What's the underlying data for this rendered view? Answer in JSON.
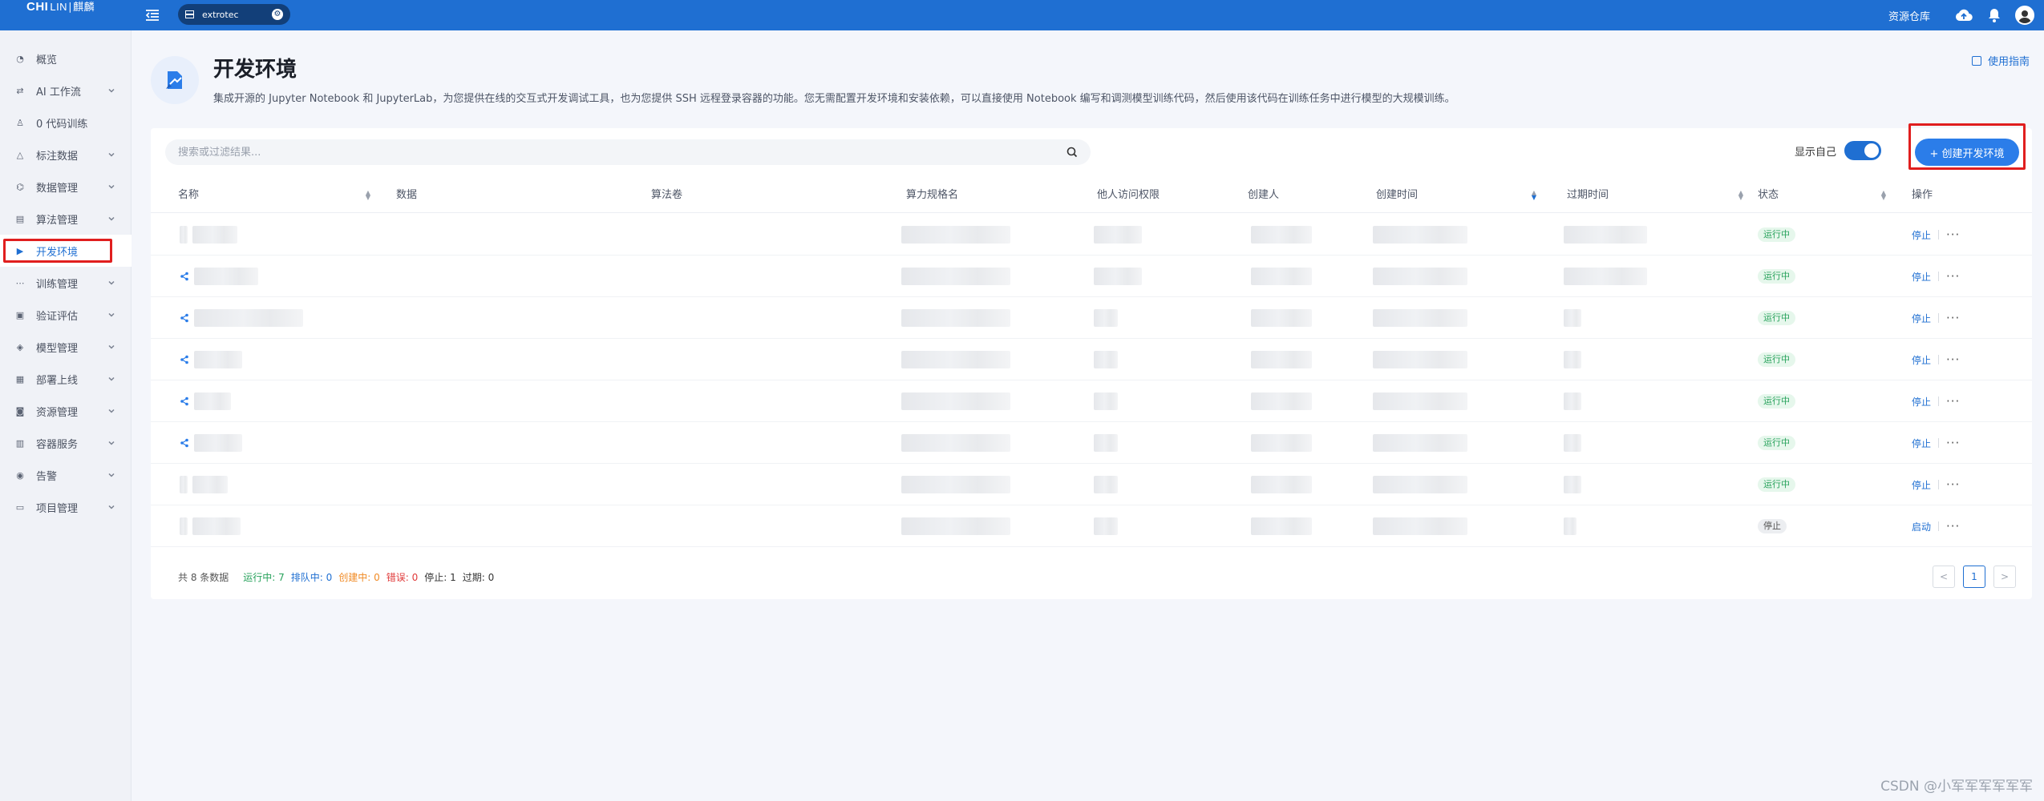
{
  "topbar": {
    "logo_main": "CHI",
    "logo_sub": "LIN∣麒麟",
    "workspace": "extrotec",
    "repo_label": "资源仓库"
  },
  "sidebar": {
    "items": [
      {
        "label": "概览",
        "icon": "dashboard-icon",
        "has_arrow": false
      },
      {
        "label": "AI 工作流",
        "icon": "workflow-icon",
        "has_arrow": true
      },
      {
        "label": "0 代码训练",
        "icon": "robot-icon",
        "has_arrow": false
      },
      {
        "label": "标注数据",
        "icon": "annotate-icon",
        "has_arrow": true
      },
      {
        "label": "数据管理",
        "icon": "data-icon",
        "has_arrow": true
      },
      {
        "label": "算法管理",
        "icon": "algorithm-icon",
        "has_arrow": true
      },
      {
        "label": "开发环境",
        "icon": "dev-env-icon",
        "has_arrow": false,
        "active": true
      },
      {
        "label": "训练管理",
        "icon": "training-icon",
        "has_arrow": true
      },
      {
        "label": "验证评估",
        "icon": "evaluate-icon",
        "has_arrow": true
      },
      {
        "label": "模型管理",
        "icon": "model-icon",
        "has_arrow": true
      },
      {
        "label": "部署上线",
        "icon": "deploy-icon",
        "has_arrow": true
      },
      {
        "label": "资源管理",
        "icon": "resource-icon",
        "has_arrow": true
      },
      {
        "label": "容器服务",
        "icon": "container-icon",
        "has_arrow": true
      },
      {
        "label": "告警",
        "icon": "alarm-icon",
        "has_arrow": true
      },
      {
        "label": "项目管理",
        "icon": "project-icon",
        "has_arrow": true
      }
    ]
  },
  "header": {
    "title": "开发环境",
    "description": "集成开源的 Jupyter Notebook 和 JupyterLab，为您提供在线的交互式开发调试工具，也为您提供 SSH 远程登录容器的功能。您无需配置开发环境和安装依赖，可以直接使用 Notebook 编写和调测模型训练代码，然后使用该代码在训练任务中进行模型的大规模训练。",
    "guide_label": "使用指南"
  },
  "toolbar": {
    "search_placeholder": "搜索或过滤结果...",
    "show_mine_label": "显示自己",
    "show_mine_on": true,
    "create_label": "+ 创建开发环境"
  },
  "table": {
    "columns": [
      "名称",
      "数据",
      "算法卷",
      "算力规格名",
      "他人访问权限",
      "创建人",
      "创建时间",
      "过期时间",
      "状态",
      "操作"
    ],
    "rows": [
      {
        "shared": false,
        "status": "运行中",
        "status_type": "run",
        "action": "停止"
      },
      {
        "shared": true,
        "status": "运行中",
        "status_type": "run",
        "action": "停止"
      },
      {
        "shared": true,
        "status": "运行中",
        "status_type": "run",
        "action": "停止"
      },
      {
        "shared": true,
        "status": "运行中",
        "status_type": "run",
        "action": "停止"
      },
      {
        "shared": true,
        "status": "运行中",
        "status_type": "run",
        "action": "停止"
      },
      {
        "shared": true,
        "status": "运行中",
        "status_type": "run",
        "action": "停止"
      },
      {
        "shared": false,
        "status": "运行中",
        "status_type": "run",
        "action": "停止"
      },
      {
        "shared": false,
        "status": "停止",
        "status_type": "stop",
        "action": "启动"
      }
    ],
    "more_label": "···"
  },
  "footer": {
    "total": "共 8 条数据",
    "running": "运行中: 7",
    "queued": "排队中: 0",
    "creating": "创建中: 0",
    "error": "错误: 0",
    "stopped": "停止: 1",
    "expired": "过期: 0"
  },
  "pagination": {
    "prev": "<",
    "current": "1",
    "next": ">"
  },
  "watermark": "CSDN @小军军军军军军",
  "colors": {
    "primary": "#1f6fd2",
    "running": "#27a25b",
    "highlight": "#e01e1e"
  }
}
